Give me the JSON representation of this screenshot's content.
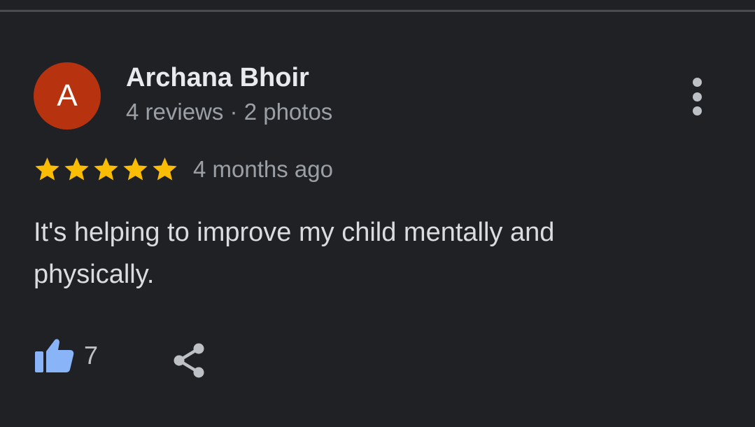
{
  "review": {
    "avatar_letter": "A",
    "reviewer_name": "Archana Bhoir",
    "reviewer_meta": "4 reviews · 2 photos",
    "rating": 5,
    "rating_max": 5,
    "time_ago": "4 months ago",
    "text": "It's helping to improve my child mentally and physically.",
    "like_count": "7"
  },
  "colors": {
    "background": "#202124",
    "avatar": "#b7330f",
    "star": "#fbbc04",
    "like_icon": "#8ab4f8"
  },
  "icons": {
    "more": "more-vert-icon",
    "like": "thumb-up-icon",
    "share": "share-icon"
  }
}
